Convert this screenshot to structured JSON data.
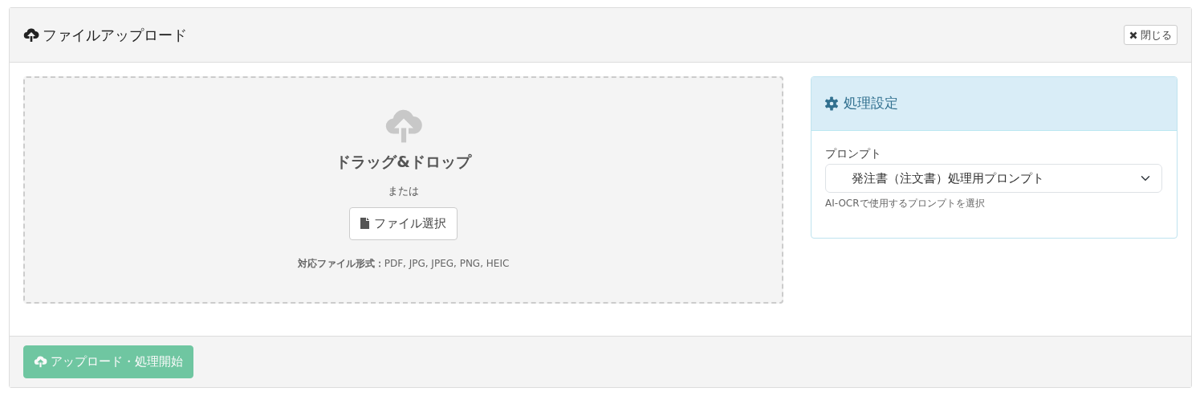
{
  "header": {
    "title": "ファイルアップロード",
    "close_button": "閉じる"
  },
  "dropzone": {
    "heading": "ドラッグ&ドロップ",
    "or_text": "または",
    "select_button": "ファイル選択",
    "formats": "**対応ファイル形式：**PDF, JPG, JPEG, PNG, HEIC"
  },
  "settings": {
    "title": "処理設定",
    "prompt_label": "プロンプト",
    "prompt_value": "発注書（注文書）処理用プロンプト",
    "prompt_help": "AI-OCRで使用するプロンプトを選択"
  },
  "footer": {
    "submit_button": {
      "label": "アップロード・処理開始",
      "disabled": true
    }
  }
}
